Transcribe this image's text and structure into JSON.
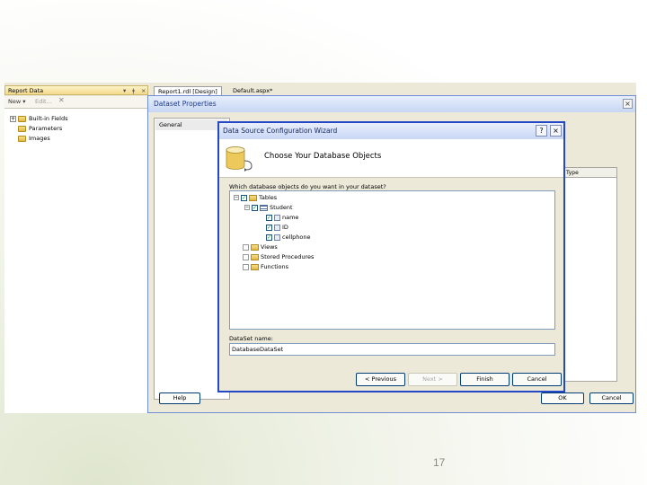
{
  "report_data": {
    "title": "Report Data",
    "controls": {
      "pin": "▾",
      "dock": "ǂ",
      "close": "×"
    },
    "toolbar": {
      "new": "New ▾",
      "edit": "Edit...",
      "delete": "✕"
    },
    "tree": [
      {
        "label": "Built-in Fields",
        "expander": "+"
      },
      {
        "label": "Parameters"
      },
      {
        "label": "Images"
      }
    ]
  },
  "tabs": [
    {
      "label": "Report1.rdl [Design]"
    },
    {
      "label": "Default.aspx*"
    }
  ],
  "dataset_properties": {
    "title": "Dataset Properties",
    "close": "×",
    "nav_selected": "General",
    "grid_header": "Type",
    "buttons": {
      "help": "Help",
      "ok": "OK",
      "cancel": "Cancel"
    }
  },
  "wizard": {
    "title": "Data Source Configuration Wizard",
    "help": "?",
    "close": "×",
    "heading": "Choose Your Database Objects",
    "question": "Which database objects do you want in your dataset?",
    "tree": {
      "tables": "Tables",
      "student": "Student",
      "columns": [
        "name",
        "ID",
        "cellphone"
      ],
      "views": "Views",
      "procedures": "Stored Procedures",
      "functions": "Functions"
    },
    "dataset_name_label": "DataSet name:",
    "dataset_name_value": "DatabaseDataSet",
    "buttons": {
      "previous": "< Previous",
      "next": "Next >",
      "finish": "Finish",
      "cancel": "Cancel"
    }
  },
  "page_number": "17"
}
